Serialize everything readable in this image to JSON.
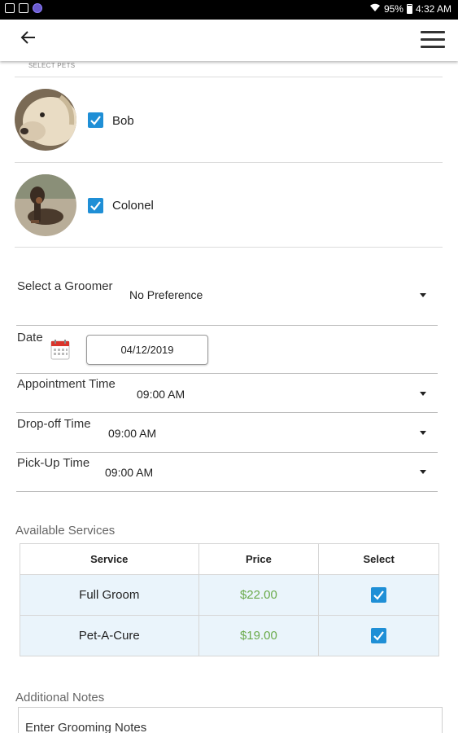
{
  "status_bar": {
    "battery": "95%",
    "time": "4:32 AM"
  },
  "section_caption": "SELECT PETS",
  "pets": [
    {
      "name": "Bob",
      "selected": true
    },
    {
      "name": "Colonel",
      "selected": true
    }
  ],
  "groomer": {
    "label": "Select a Groomer",
    "value": "No Preference"
  },
  "date": {
    "label": "Date",
    "value": "04/12/2019"
  },
  "appointment_time": {
    "label": "Appointment Time",
    "value": "09:00 AM"
  },
  "dropoff_time": {
    "label": "Drop-off Time",
    "value": "09:00 AM"
  },
  "pickup_time": {
    "label": "Pick-Up Time",
    "value": "09:00 AM"
  },
  "services": {
    "title": "Available Services",
    "headers": [
      "Service",
      "Price",
      "Select"
    ],
    "rows": [
      {
        "service": "Full Groom",
        "price": "$22.00",
        "selected": true
      },
      {
        "service": "Pet-A-Cure",
        "price": "$19.00",
        "selected": true
      }
    ]
  },
  "notes": {
    "title": "Additional Notes",
    "placeholder": "Enter Grooming Notes"
  },
  "colors": {
    "accent": "#1f8fd6",
    "price": "#6aaa4a",
    "row_bg": "#eaf4fb"
  }
}
